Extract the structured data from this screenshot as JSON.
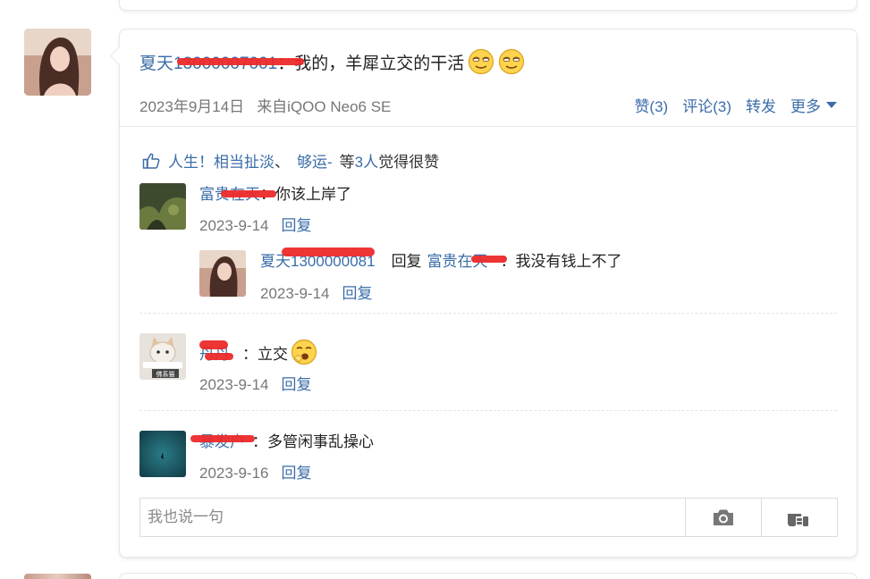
{
  "post": {
    "author": "夏天1300000",
    "author_suffix": "7001",
    "colon": "：",
    "text": "我的，羊犀立交的干活",
    "date": "2023年9月14日",
    "source": "来自iQOO Neo6 SE",
    "actions": {
      "like": "赞(3)",
      "comment": "评论(3)",
      "repost": "转发",
      "more": "更多"
    }
  },
  "likes": {
    "names": [
      "人生！相当扯淡",
      "、",
      "够运-"
    ],
    "suffix_count": "等3人",
    "suffix_text": "觉得很赞"
  },
  "comments": [
    {
      "name": "富贵在天",
      "text": "：你该上岸了",
      "date": "2023-9-14",
      "reply_label": "回复"
    },
    {
      "name": "夏天1300000",
      "name_tail": "081",
      "reply_word": "回复",
      "reply_to": "富贵在天",
      "text": "：我没有钱上不了",
      "date": "2023-9-14",
      "reply_label": "回复"
    },
    {
      "name": "丹丹",
      "text": "：立交",
      "date": "2023-9-14",
      "reply_label": "回复",
      "avatar_caption": "佛系猫"
    },
    {
      "name": "暴发户",
      "text": "：多管闲事乱操心",
      "date": "2023-9-16",
      "reply_label": "回复"
    }
  ],
  "comment_box": {
    "placeholder": "我也说一句"
  },
  "colors": {
    "link": "#3b6da8",
    "redaction": "#ec2a2a",
    "meta": "#777777"
  },
  "icons": [
    "thumbs-up-icon",
    "camera-icon",
    "pointing-hand-icon",
    "squint-emoji-icon",
    "yawn-emoji-icon",
    "caret-down-icon"
  ]
}
